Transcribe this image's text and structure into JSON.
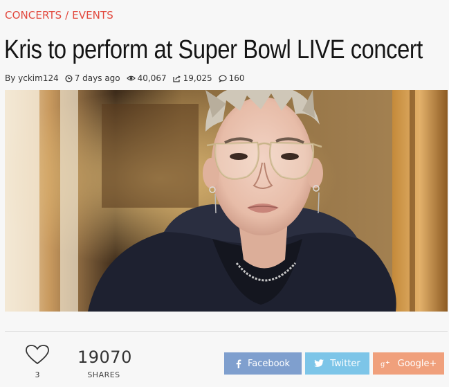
{
  "category": "CONCERTS / EVENTS",
  "article": {
    "title": "Kris to perform at Super Bowl LIVE concert"
  },
  "meta": {
    "author": "By yckim124",
    "time": "7 days ago",
    "views": "40,067",
    "shares": "19,025",
    "comments": "160"
  },
  "hero_image": {
    "description": "Portrait photo"
  },
  "engagement": {
    "likes": "3",
    "share_count": "19070",
    "share_label": "SHARES"
  },
  "share_buttons": {
    "facebook": "Facebook",
    "twitter": "Twitter",
    "googleplus": "Google+"
  },
  "colors": {
    "category": "#e2483d",
    "facebook": "#7f9fce",
    "twitter": "#7dc5e8",
    "googleplus": "#f0a07c"
  },
  "icons": [
    "clock-icon",
    "eye-icon",
    "share-icon",
    "comment-icon",
    "heart-icon",
    "facebook-icon",
    "twitter-icon",
    "googleplus-icon"
  ]
}
